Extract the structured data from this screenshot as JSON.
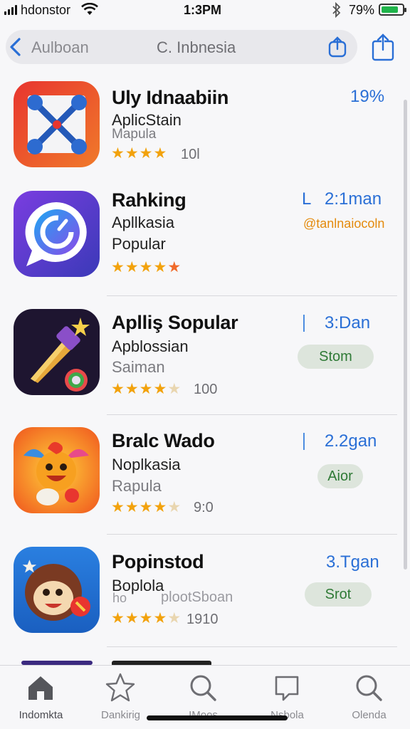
{
  "status_bar": {
    "carrier": "hdonstor",
    "time": "1:3PM",
    "battery": "79%"
  },
  "nav": {
    "back_label": "Aulboan",
    "search_text": "C. Inbnesia"
  },
  "apps": [
    {
      "title": "Uly Idnaabiin",
      "subtitle": "AplicStain",
      "subtitle2": "Mapula",
      "rating_stars": 4,
      "count": "10l",
      "right_text": "19%",
      "icon": "crossed-tools-icon"
    },
    {
      "title": "Rahking",
      "subtitle": "Apllkasia",
      "subtitle2": "Popular",
      "rating_stars": 4.5,
      "right_text": "2:1man",
      "right_prefix": "L",
      "right_note": "@tanlnaiocoln",
      "icon": "chat-bubble-icon"
    },
    {
      "title": "Aplliş Sopular",
      "subtitle": "Apblossian",
      "subtitle2": "Saiman",
      "rating_stars": 4.5,
      "count": "100",
      "right_text": "3:Dan",
      "pill": "Stom",
      "icon": "magic-wand-icon"
    },
    {
      "title": "Bralc Wado",
      "subtitle": "Noplkasia",
      "subtitle2": "Rapula",
      "rating_stars": 4.5,
      "count": "9:0",
      "right_text": "2.2gan",
      "pill": "Aior",
      "icon": "cartoon-bird-icon"
    },
    {
      "title": "Popinstod",
      "subtitle": "Boplola",
      "subtitle_overlay": "plootSboan",
      "subtitle_overlay_prefix": "ho",
      "rating_stars": 4.5,
      "count": "1910",
      "right_text": "3.Tgan",
      "pill": "Srot",
      "icon": "cartoon-monkey-icon"
    }
  ],
  "tabs": [
    {
      "label": "Indomkta",
      "icon": "home-icon"
    },
    {
      "label": "Dankirig",
      "icon": "star-icon"
    },
    {
      "label": "IMoos",
      "icon": "search-icon"
    },
    {
      "label": "Nsbola",
      "icon": "chat-icon"
    },
    {
      "label": "Olenda",
      "icon": "search-icon"
    }
  ],
  "colors": {
    "accent": "#2a6fd6",
    "star": "#f2a20c",
    "pill_text": "#2f7a36",
    "orange_note": "#e48a0c"
  }
}
